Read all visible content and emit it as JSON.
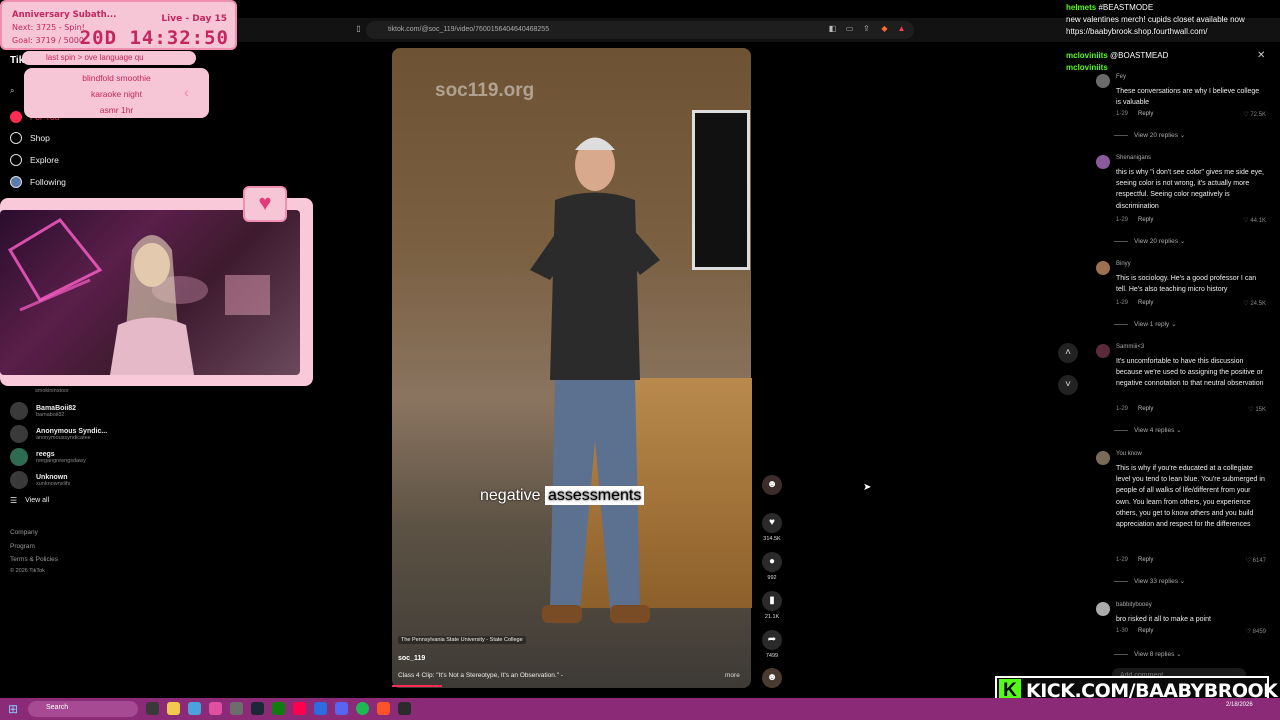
{
  "browser": {
    "url": "tiktok.com/@soc_119/video/7600156404640468255"
  },
  "subathon": {
    "title": "Anniversary Subath...",
    "live": "Live - Day 15",
    "next": "Next: 3725 - Spin!",
    "goal": "Goal: 3719 / 5000",
    "timer": "20D 14:32:50"
  },
  "spin": {
    "bar": "last spin  >  ove language qu",
    "items": [
      "blindfold smoothie",
      "karaoke night",
      "asmr 1hr"
    ]
  },
  "sidebar": {
    "logo": "TikTok",
    "nav": [
      {
        "label": "For You",
        "icon": "home-icon"
      },
      {
        "label": "Shop",
        "icon": "shop-icon"
      },
      {
        "label": "Explore",
        "icon": "compass-icon"
      },
      {
        "label": "Following",
        "icon": "following-icon"
      }
    ],
    "following": [
      {
        "name": "",
        "handle": "smokininstoor"
      },
      {
        "name": "BamaBoii82",
        "handle": "bamaboii82"
      },
      {
        "name": "Anonymous Syndic...",
        "handle": "anonymoussyndicatee"
      },
      {
        "name": "reegs",
        "handle": "reegangreengsdawy"
      },
      {
        "name": "Unknown",
        "handle": "xunknownxlifx"
      }
    ],
    "view_all": "View all",
    "footer": [
      "Company",
      "Program",
      "Terms & Policies",
      "© 2026 TikTok"
    ]
  },
  "video": {
    "watermark": "soc119.org",
    "caption_plain": "negative",
    "caption_highlight": "assessments",
    "place": "The Pennsylvania State University - State College",
    "user": "soc_119",
    "description": "Class 4 Clip: \"It's Not a Stereotype, It's an Observation.\" -",
    "more": "more"
  },
  "actions": {
    "likes": "314.5K",
    "comments": "992",
    "saves": "21.1K",
    "shares": "7499"
  },
  "comments": [
    {
      "name": "Fey",
      "text": "These conversations are why I believe college is valuable",
      "time": "1-29",
      "reply": "Reply",
      "likes": "72.5K",
      "view_replies": "View 20 replies"
    },
    {
      "name": "Shenanigans",
      "text": "this is why \"i don't see color\" gives me side eye, seeing color is not wrong, it's actually more respectful. Seeing color negatively is discrimination",
      "time": "1-29",
      "reply": "Reply",
      "likes": "44.1K",
      "view_replies": "View 20 replies"
    },
    {
      "name": "Binyy",
      "text": "This is sociology. He's a good professor I can tell. He's also teaching micro history",
      "time": "1-29",
      "reply": "Reply",
      "likes": "24.5K",
      "view_replies": "View 1 reply"
    },
    {
      "name": "Sammiii<3",
      "text": "It's uncomfortable to have this discussion because we're used to assigning the positive or negative connotation to that neutral observation",
      "time": "1-29",
      "reply": "Reply",
      "likes": "15K",
      "view_replies": "View 4 replies"
    },
    {
      "name": "You know",
      "text": "This is why if you're educated at a collegiate level you tend to lean blue. You're submerged in people of all walks of life/different from your own. You learn from others, you experience others, you get to know others and you build appreciation and respect for the differences",
      "time": "1-29",
      "reply": "Reply",
      "likes": "6147",
      "view_replies": "View 33 replies"
    },
    {
      "name": "babbitybooey",
      "text": "bro risked it all to make a point",
      "time": "1-30",
      "reply": "Reply",
      "likes": "8459",
      "view_replies": "View 8 replies"
    }
  ],
  "comment_input": {
    "placeholder": "Add comment..."
  },
  "chat": [
    {
      "user": "helmets",
      "msg": "#BEASTMODE"
    },
    {
      "user": "",
      "msg": "new valentines merch! cupids closet available now https://baabybrook.shop.fourthwall.com/"
    },
    {
      "user": "mcloviniits",
      "msg": "@BOASTMEAD"
    },
    {
      "user": "mcloviniits",
      "msg": ""
    }
  ],
  "kick": {
    "logo": "K",
    "text": "KICK.COM/BAABYBROOK"
  },
  "taskbar": {
    "search": "Search",
    "date": "2/18/2026"
  },
  "colors": {
    "pink_panel": "#f6c6d6",
    "pink_text": "#c4265f",
    "kick_green": "#53fc18",
    "taskbar": "#8b2a77"
  }
}
